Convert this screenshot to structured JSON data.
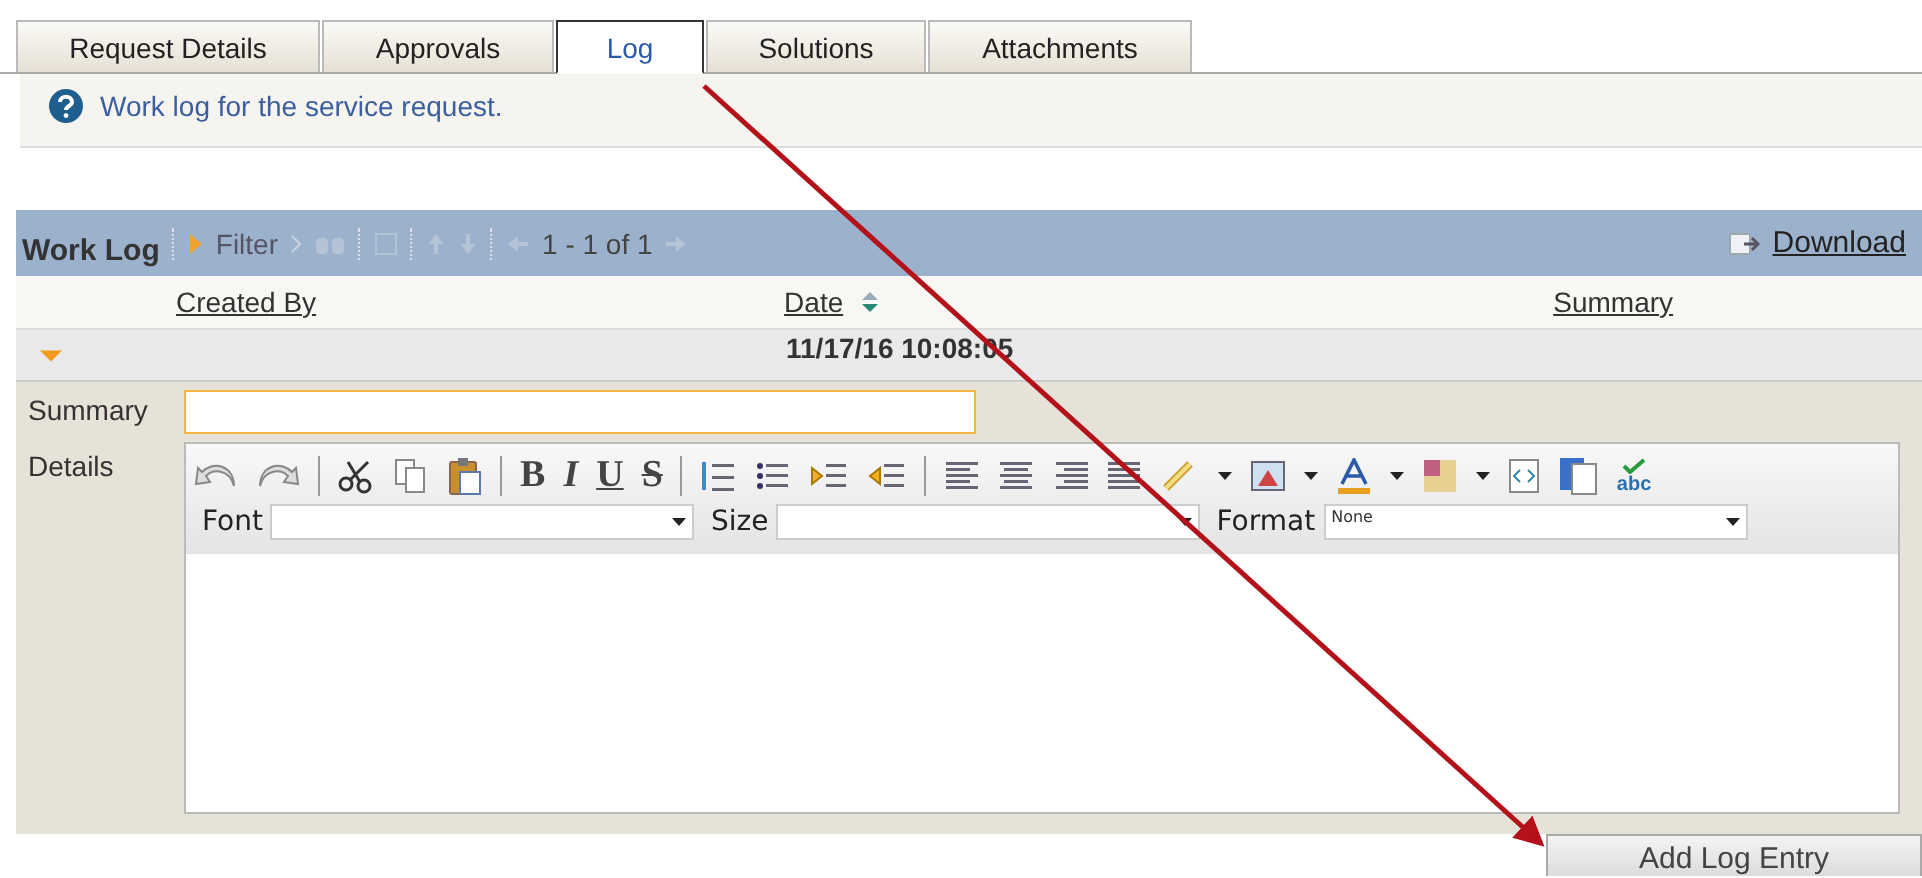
{
  "tabs": [
    {
      "label": "Request Details",
      "selected": false
    },
    {
      "label": "Approvals",
      "selected": false
    },
    {
      "label": "Log",
      "selected": true
    },
    {
      "label": "Solutions",
      "selected": false
    },
    {
      "label": "Attachments",
      "selected": false
    }
  ],
  "info": {
    "text": "Work log for the service request."
  },
  "work_log": {
    "title": "Work Log",
    "filter": "Filter",
    "pager": "1 - 1 of 1",
    "download": "Download",
    "columns": [
      "Created By",
      "Date",
      "Summary"
    ],
    "rows": [
      {
        "expanded": true,
        "date": "11/17/16 10:08:05"
      }
    ]
  },
  "form": {
    "summary_label": "Summary",
    "details_label": "Details",
    "style_buttons": [
      {
        "kind": "bold",
        "label": "B"
      },
      {
        "kind": "italic",
        "label": "I"
      },
      {
        "kind": "underline",
        "label": "U"
      },
      {
        "kind": "strike",
        "label": "S"
      }
    ],
    "spellcheck": "abc",
    "font_label": "Font",
    "size_label": "Size",
    "format_label": "Format",
    "format_value": "None"
  },
  "add_button": "Add Log Entry"
}
